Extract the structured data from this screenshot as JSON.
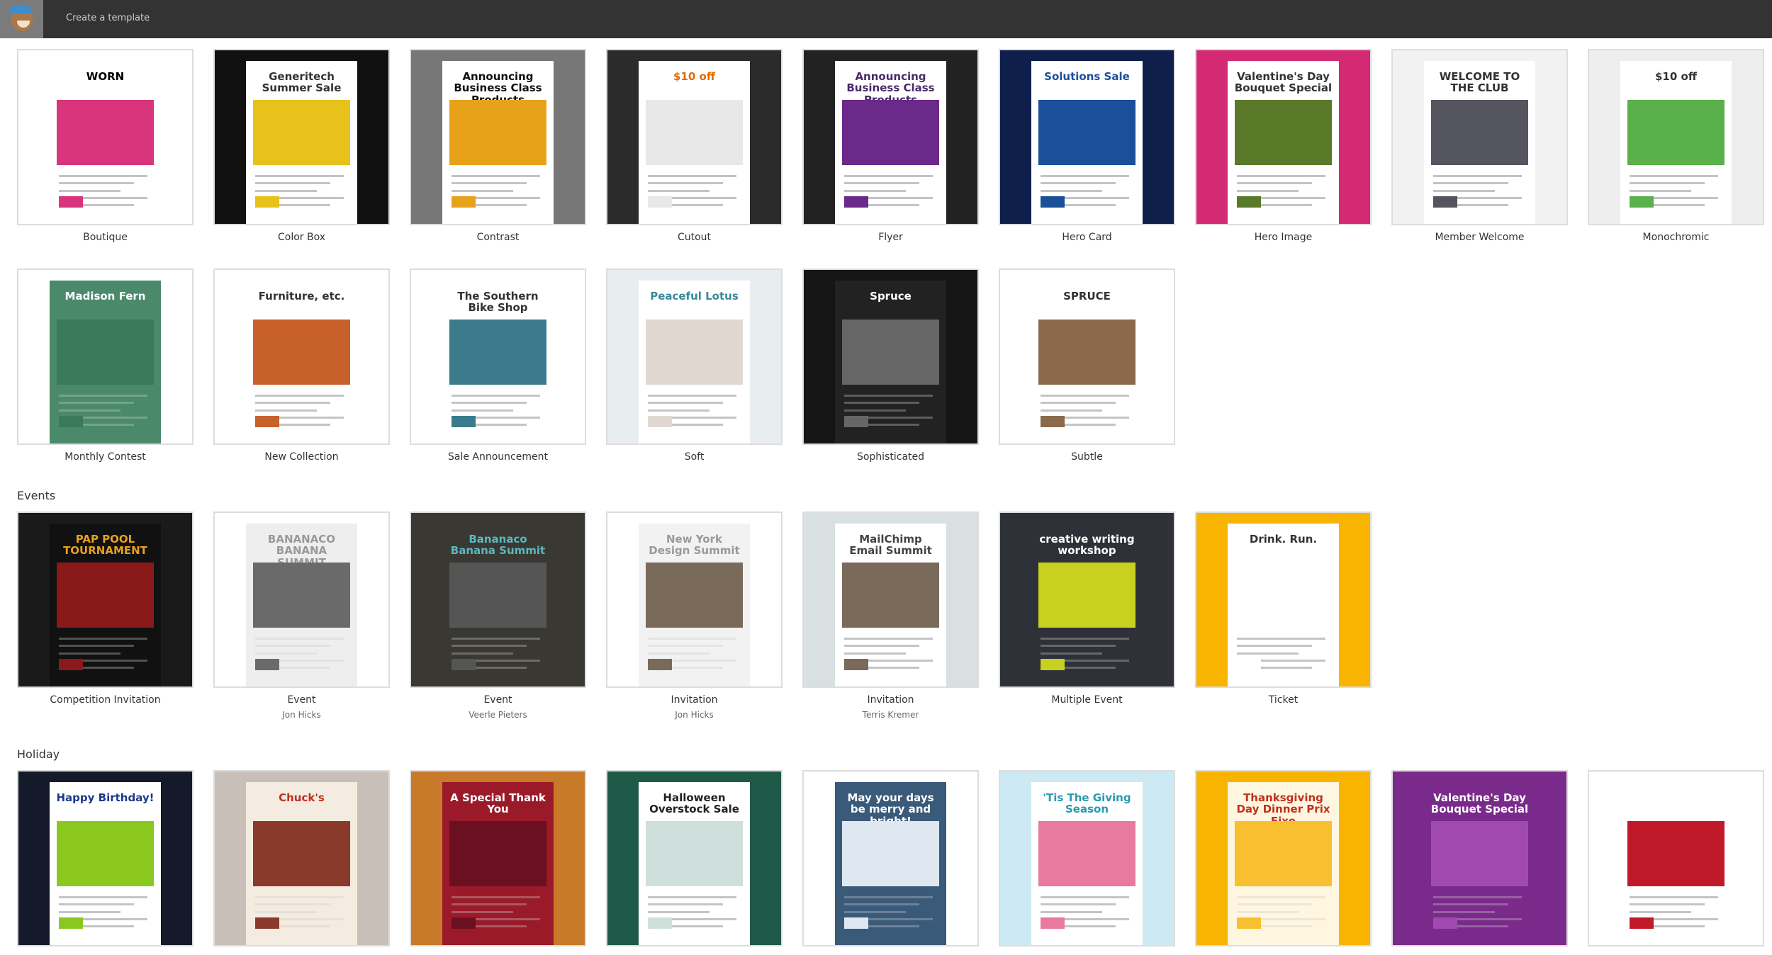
{
  "header": {
    "title": "Create a template",
    "logo": "mailchimp-freddie-logo"
  },
  "sections": [
    {
      "heading": "",
      "items": [
        {
          "name": "Boutique",
          "author": "",
          "bg": "#ffffff",
          "panel": "#ffffff",
          "hero": "#d9357c",
          "text": "WORN",
          "color": "#000000"
        },
        {
          "name": "Color Box",
          "author": "",
          "bg": "#111111",
          "panel": "#ffffff",
          "hero": "#e8c21a",
          "text": "Generitech Summer Sale",
          "color": "#333333"
        },
        {
          "name": "Contrast",
          "author": "",
          "bg": "#777777",
          "panel": "#ffffff",
          "hero": "#e8a21a",
          "text": "Announcing Business Class Products",
          "color": "#111111"
        },
        {
          "name": "Cutout",
          "author": "",
          "bg": "#2b2b2b",
          "panel": "#ffffff",
          "hero": "#e8e8e8",
          "text": "$10 off",
          "color": "#e06a00"
        },
        {
          "name": "Flyer",
          "author": "",
          "bg": "#222222",
          "panel": "#ffffff",
          "hero": "#6b2a8a",
          "text": "Announcing Business Class Products",
          "color": "#4a2a6a"
        },
        {
          "name": "Hero Card",
          "author": "",
          "bg": "#0d1f4a",
          "panel": "#ffffff",
          "hero": "#1c4f9a",
          "text": "Solutions Sale",
          "color": "#1c4f9a"
        },
        {
          "name": "Hero Image",
          "author": "",
          "bg": "#d42a74",
          "panel": "#ffffff",
          "hero": "#5a7a2a",
          "text": "Valentine's Day Bouquet Special",
          "color": "#ffffff"
        },
        {
          "name": "Member Welcome",
          "author": "",
          "bg": "#f2f2f2",
          "panel": "#ffffff",
          "hero": "#555560",
          "text": "WELCOME TO THE CLUB",
          "color": "#333333"
        },
        {
          "name": "Monochromic",
          "author": "",
          "bg": "#eeeeee",
          "panel": "#ffffff",
          "hero": "#5ab04a",
          "text": "$10 off",
          "color": "#333333"
        }
      ]
    },
    {
      "heading": "",
      "items": [
        {
          "name": "Monthly Contest",
          "author": "",
          "bg": "#ffffff",
          "panel": "#4a8a6a",
          "hero": "#3a7a5a",
          "text": "Madison Fern",
          "color": "#ffffff"
        },
        {
          "name": "New Collection",
          "author": "",
          "bg": "#ffffff",
          "panel": "#ffffff",
          "hero": "#c8602a",
          "text": "Furniture, etc.",
          "color": "#ffffff"
        },
        {
          "name": "Sale Announcement",
          "author": "",
          "bg": "#ffffff",
          "panel": "#ffffff",
          "hero": "#3a7a8a",
          "text": "The Southern Bike Shop",
          "color": "#ffffff"
        },
        {
          "name": "Soft",
          "author": "",
          "bg": "#e8eef0",
          "panel": "#ffffff",
          "hero": "#e0d8d0",
          "text": "Peaceful Lotus",
          "color": "#3a8a9a"
        },
        {
          "name": "Sophisticated",
          "author": "",
          "bg": "#151515",
          "panel": "#222222",
          "hero": "#666666",
          "text": "Spruce",
          "color": "#ffffff"
        },
        {
          "name": "Subtle",
          "author": "",
          "bg": "#ffffff",
          "panel": "#ffffff",
          "hero": "#8a6a4a",
          "text": "SPRUCE",
          "color": "#ffffff"
        }
      ]
    },
    {
      "heading": "Events",
      "items": [
        {
          "name": "Competition Invitation",
          "author": "",
          "bg": "#1a1a1a",
          "panel": "#111111",
          "hero": "#8a1a1a",
          "text": "PAP POOL TOURNAMENT",
          "color": "#e8a020"
        },
        {
          "name": "Event",
          "author": "Jon Hicks",
          "bg": "#ffffff",
          "panel": "#eeeeee",
          "hero": "#6a6a6a",
          "text": "BANANACO BANANA SUMMIT",
          "color": "#999999"
        },
        {
          "name": "Event",
          "author": "Veerle Pieters",
          "bg": "#3a3832",
          "panel": "#3a3832",
          "hero": "#555555",
          "text": "Bananaco Banana Summit",
          "color": "#5ab8c0"
        },
        {
          "name": "Invitation",
          "author": "Jon Hicks",
          "bg": "#ffffff",
          "panel": "#f2f2f2",
          "hero": "#7a6a5a",
          "text": "New York Design Summit",
          "color": "#999999"
        },
        {
          "name": "Invitation",
          "author": "Terris Kremer",
          "bg": "#d8e0e2",
          "panel": "#ffffff",
          "hero": "#7a6a5a",
          "text": "MailChimp Email Summit",
          "color": "#444444"
        },
        {
          "name": "Multiple Event",
          "author": "",
          "bg": "#2e3238",
          "panel": "#2e3238",
          "hero": "#c8d020",
          "text": "creative writing workshop",
          "color": "#ffffff"
        },
        {
          "name": "Ticket",
          "author": "",
          "bg": "#f8b400",
          "panel": "#ffffff",
          "hero": "#ffffff",
          "text": "Drink. Run.",
          "color": "#222222"
        }
      ]
    },
    {
      "heading": "Holiday",
      "items": [
        {
          "name": "",
          "author": "",
          "bg": "#151a2a",
          "panel": "#ffffff",
          "hero": "#8ac820",
          "text": "Happy Birthday!",
          "color": "#1a3a8a"
        },
        {
          "name": "",
          "author": "",
          "bg": "#c8c0b8",
          "panel": "#f4ece0",
          "hero": "#8a3a2a",
          "text": "Chuck's",
          "color": "#c03020"
        },
        {
          "name": "",
          "author": "",
          "bg": "#c87a2a",
          "panel": "#9a1a2a",
          "hero": "#6a1020",
          "text": "A Special Thank You",
          "color": "#ffffff"
        },
        {
          "name": "",
          "author": "",
          "bg": "#1f5a48",
          "panel": "#ffffff",
          "hero": "#cfe0dc",
          "text": "Halloween Overstock Sale",
          "color": "#222222"
        },
        {
          "name": "",
          "author": "",
          "bg": "#ffffff",
          "panel": "#3a5a7a",
          "hero": "#dfe8f0",
          "text": "May your days be merry and bright!",
          "color": "#ffffff"
        },
        {
          "name": "",
          "author": "",
          "bg": "#cdeaf4",
          "panel": "#ffffff",
          "hero": "#e87aa0",
          "text": "'Tis The Giving Season",
          "color": "#2a9ab0"
        },
        {
          "name": "",
          "author": "",
          "bg": "#f8b400",
          "panel": "#fff6e0",
          "hero": "#f8c030",
          "text": "Thanksgiving Day Dinner Prix Fixe",
          "color": "#c03020"
        },
        {
          "name": "",
          "author": "",
          "bg": "#7a2a8a",
          "panel": "#7a2a8a",
          "hero": "#a04ab0",
          "text": "Valentine's Day Bouquet Special",
          "color": "#ffffff"
        },
        {
          "name": "",
          "author": "",
          "bg": "#ffffff",
          "panel": "#ffffff",
          "hero": "#c01a2a",
          "text": "",
          "color": "#1a3a8a"
        }
      ]
    }
  ]
}
